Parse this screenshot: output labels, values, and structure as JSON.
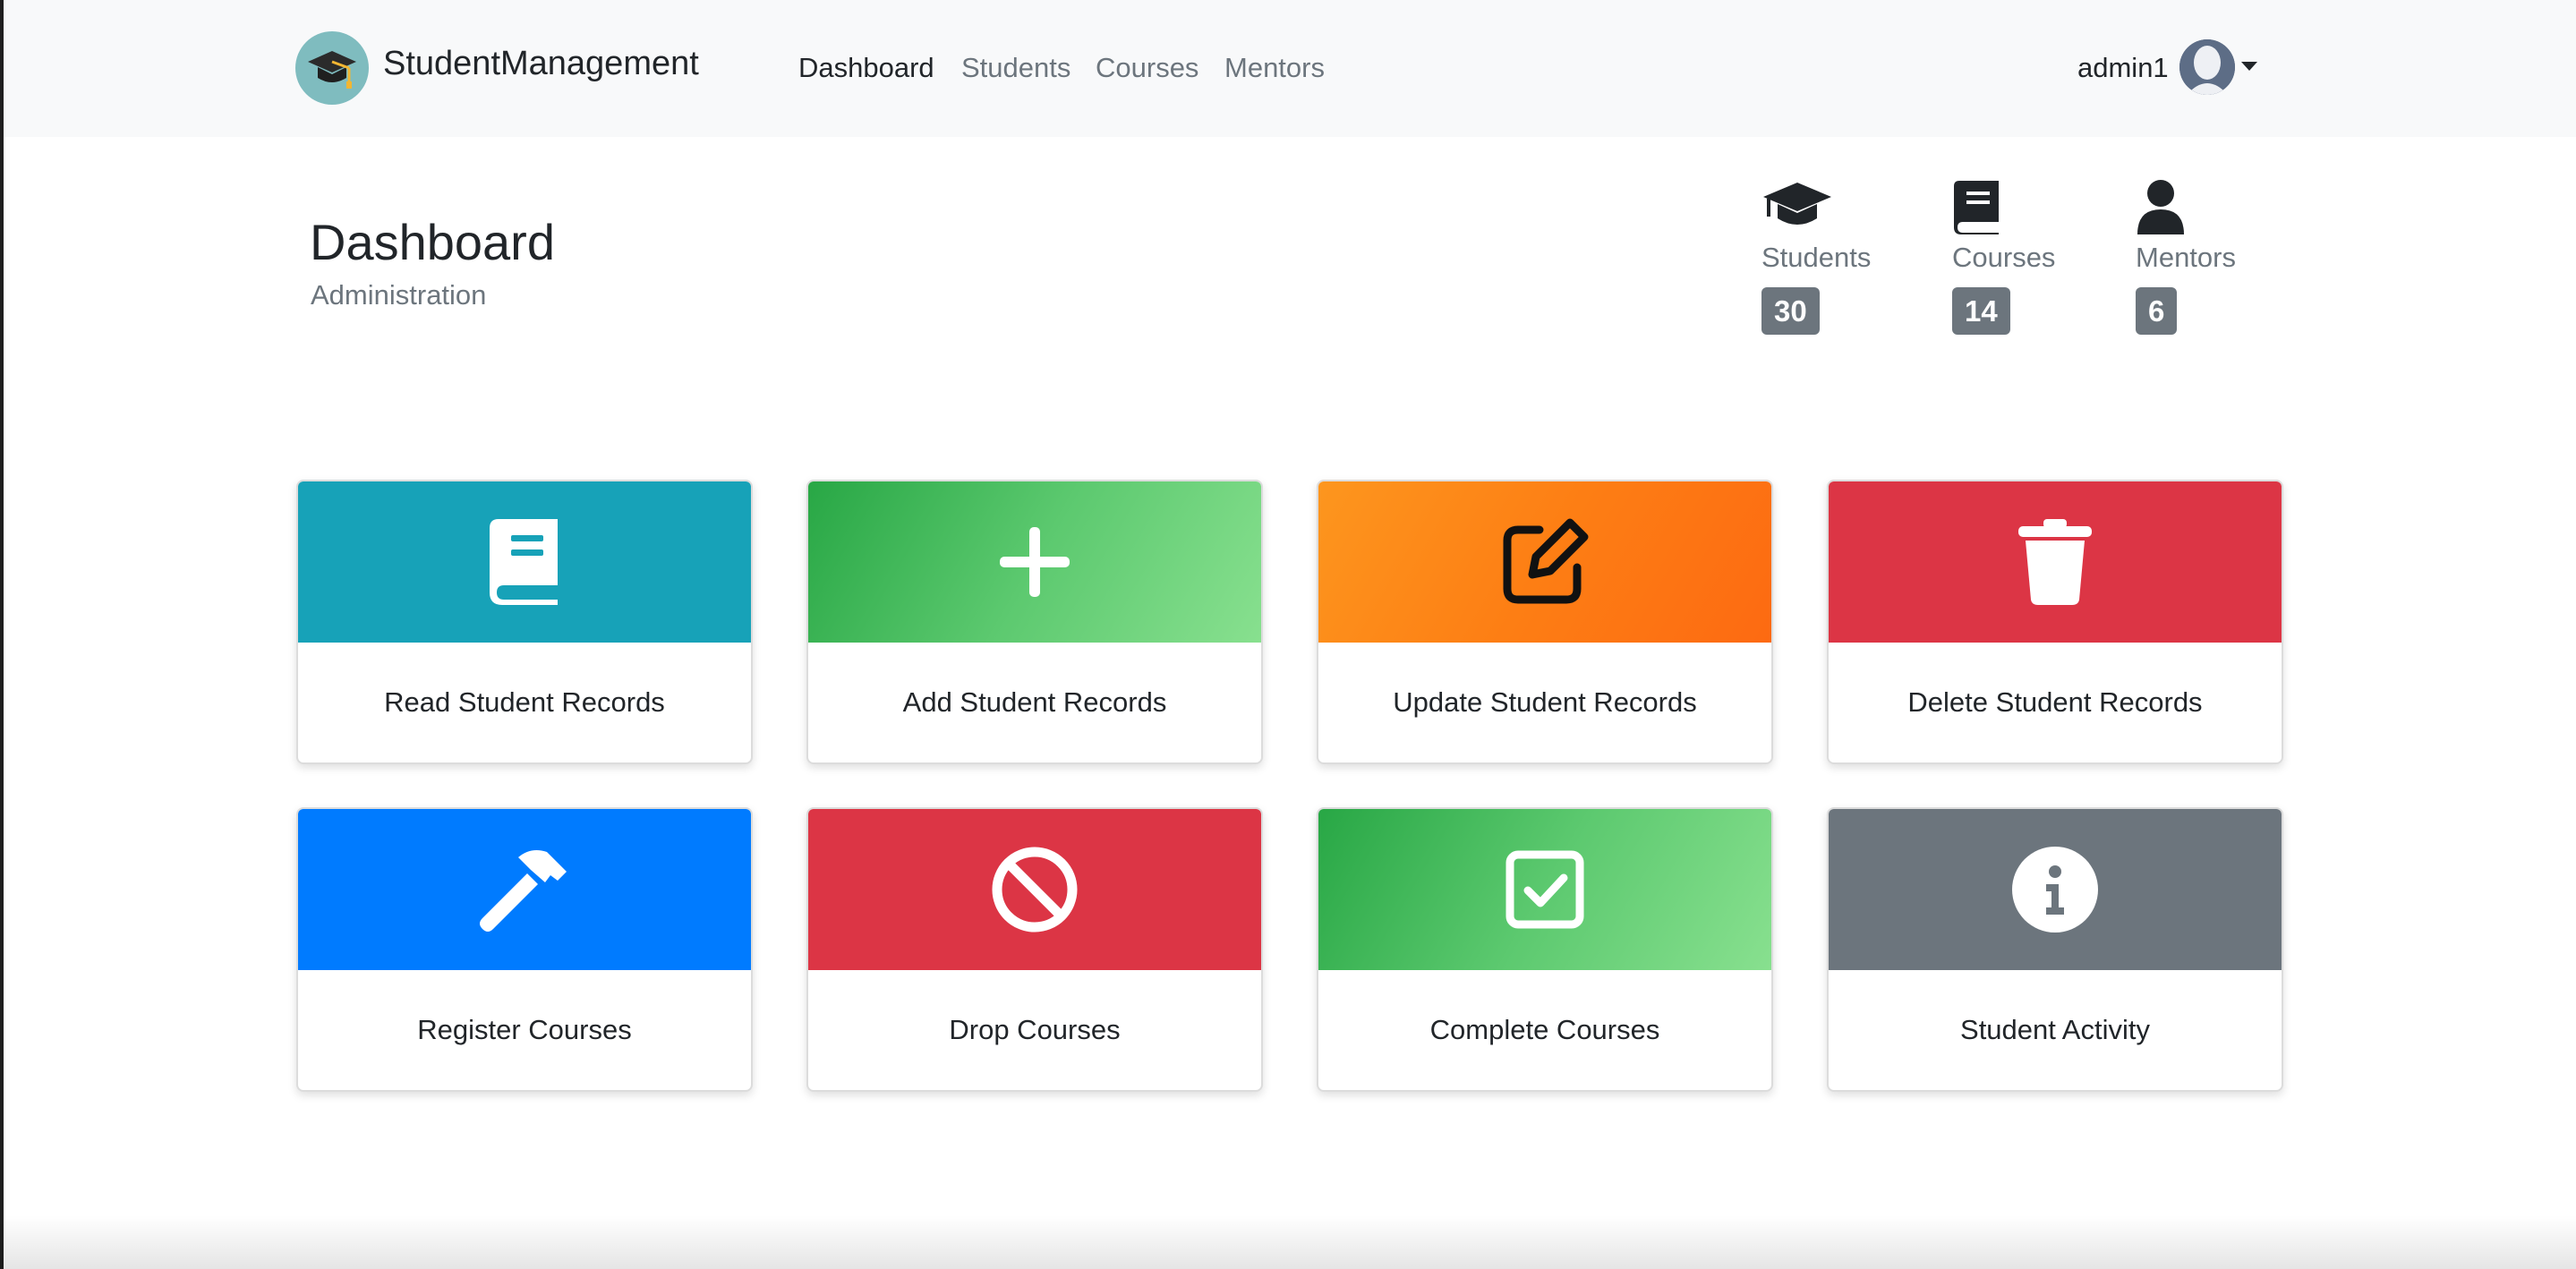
{
  "navbar": {
    "brand": "StudentManagement",
    "links": [
      "Dashboard",
      "Students",
      "Courses",
      "Mentors"
    ],
    "active_link": "Dashboard",
    "user": "admin1"
  },
  "header": {
    "title": "Dashboard",
    "subtitle": "Administration"
  },
  "stats": [
    {
      "label": "Students",
      "count": "30",
      "icon": "graduation-cap-icon"
    },
    {
      "label": "Courses",
      "count": "14",
      "icon": "book-icon"
    },
    {
      "label": "Mentors",
      "count": "6",
      "icon": "user-icon"
    }
  ],
  "cards": [
    {
      "label": "Read Student Records",
      "icon": "book-icon",
      "color": "#17a2b8"
    },
    {
      "label": "Add Student Records",
      "icon": "plus-icon",
      "color": "#28a745"
    },
    {
      "label": "Update Student Records",
      "icon": "edit-icon",
      "color": "#fd7e14"
    },
    {
      "label": "Delete Student Records",
      "icon": "trash-icon",
      "color": "#dc3545"
    },
    {
      "label": "Register Courses",
      "icon": "hammer-icon",
      "color": "#007bff"
    },
    {
      "label": "Drop Courses",
      "icon": "ban-icon",
      "color": "#dc3545"
    },
    {
      "label": "Complete Courses",
      "icon": "check-square-icon",
      "color": "#28a745"
    },
    {
      "label": "Student Activity",
      "icon": "info-icon",
      "color": "#6c757d"
    }
  ],
  "colors": {
    "navbar_bg": "#f8f9fa",
    "badge_bg": "#6c757d",
    "text": "#212529",
    "muted": "#6c757d"
  }
}
